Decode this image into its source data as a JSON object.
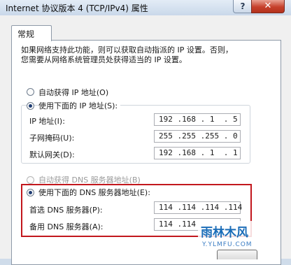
{
  "window": {
    "title": "Internet 协议版本 4 (TCP/IPv4) 属性",
    "help_label": "?",
    "close_label": "✕"
  },
  "tabs": [
    {
      "label": "常规"
    }
  ],
  "description": {
    "line1": "如果网络支持此功能，则可以获取自动指派的 IP 设置。否则，",
    "line2": "您需要从网络系统管理员处获得适当的 IP 设置。"
  },
  "ip": {
    "auto_label": "自动获得 IP 地址(O)",
    "manual_label": "使用下面的 IP 地址(S):",
    "selected": "manual",
    "fields": [
      {
        "label": "IP 地址(I):",
        "value": "192 .168 . 1  . 5"
      },
      {
        "label": "子网掩码(U):",
        "value": "255 .255 .255 . 0"
      },
      {
        "label": "默认网关(D):",
        "value": "192 .168 . 1  . 1"
      }
    ]
  },
  "dns": {
    "auto_label": "自动获得 DNS 服务器地址(B)",
    "manual_label": "使用下面的 DNS 服务器地址(E):",
    "selected": "manual",
    "fields": [
      {
        "label": "首选 DNS 服务器(P):",
        "value": "114 .114 .114 .114"
      },
      {
        "label": "备用 DNS 服务器(A):",
        "value": "114 .114"
      }
    ]
  },
  "watermark": {
    "main": "雨林木风",
    "sub": "Y.YLMFU.COM"
  },
  "colors": {
    "highlight_box": "#c2171d",
    "close_button": "#c6412c"
  }
}
